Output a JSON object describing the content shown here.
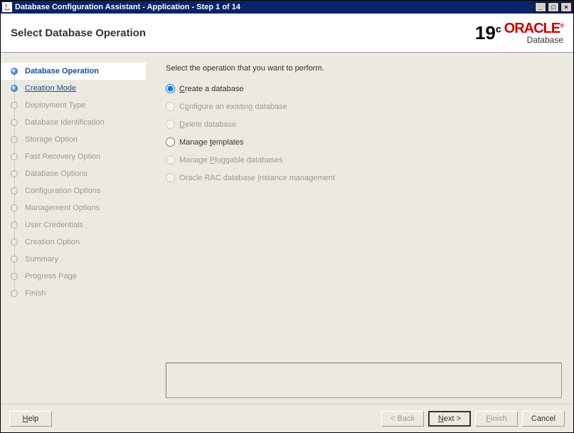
{
  "titlebar": {
    "title": "Database Configuration Assistant - Application - Step 1 of 14"
  },
  "header": {
    "title": "Select Database Operation",
    "logo_version": "19",
    "logo_c": "c",
    "logo_brand": "ORACLE",
    "logo_reg": "®",
    "logo_product": "Database"
  },
  "sidebar": {
    "items": [
      {
        "label": "Database Operation",
        "state": "current"
      },
      {
        "label": "Creation Mode",
        "state": "link"
      },
      {
        "label": "Deployment Type",
        "state": "disabled"
      },
      {
        "label": "Database Identification",
        "state": "disabled"
      },
      {
        "label": "Storage Option",
        "state": "disabled"
      },
      {
        "label": "Fast Recovery Option",
        "state": "disabled"
      },
      {
        "label": "Database Options",
        "state": "disabled"
      },
      {
        "label": "Configuration Options",
        "state": "disabled"
      },
      {
        "label": "Management Options",
        "state": "disabled"
      },
      {
        "label": "User Credentials",
        "state": "disabled"
      },
      {
        "label": "Creation Option",
        "state": "disabled"
      },
      {
        "label": "Summary",
        "state": "disabled"
      },
      {
        "label": "Progress Page",
        "state": "disabled"
      },
      {
        "label": "Finish",
        "state": "disabled"
      }
    ]
  },
  "main": {
    "instruction": "Select the operation that you want to perform.",
    "options": [
      {
        "label_pre": "",
        "u": "C",
        "label_post": "reate a database",
        "enabled": true,
        "selected": true
      },
      {
        "label_pre": "C",
        "u": "o",
        "label_post": "nfigure an existing database",
        "enabled": false,
        "selected": false
      },
      {
        "label_pre": "",
        "u": "D",
        "label_post": "elete database",
        "enabled": false,
        "selected": false
      },
      {
        "label_pre": "Manage ",
        "u": "t",
        "label_post": "emplates",
        "enabled": true,
        "selected": false
      },
      {
        "label_pre": "Manage ",
        "u": "P",
        "label_post": "luggable databases",
        "enabled": false,
        "selected": false
      },
      {
        "label_pre": "Oracle RAC database ",
        "u": "I",
        "label_post": "nstance management",
        "enabled": false,
        "selected": false
      }
    ]
  },
  "footer": {
    "help": "Help",
    "back": "< Back",
    "next_pre": "",
    "next_u": "N",
    "next_post": "ext >",
    "finish_pre": "",
    "finish_u": "F",
    "finish_post": "inish",
    "cancel": "Cancel"
  }
}
